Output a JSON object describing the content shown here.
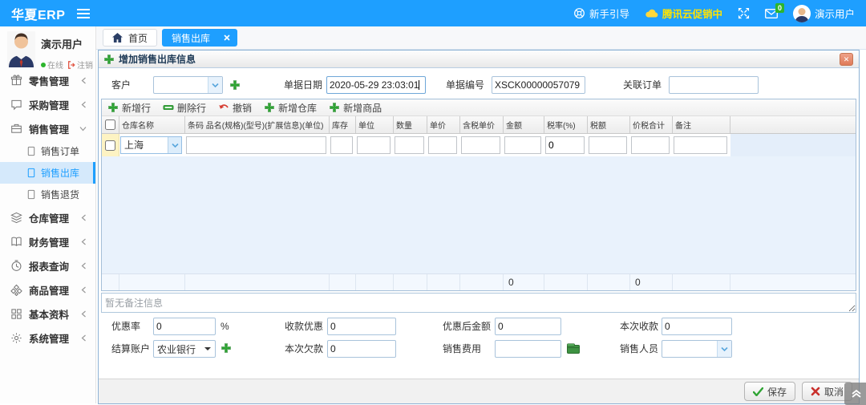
{
  "topbar": {
    "brand": "华夏ERP",
    "guide": "新手引导",
    "promo": "腾讯云促销中",
    "user": "演示用户",
    "mail_badge": "0",
    "bar_color": "#1E9FFF",
    "promo_color": "#FFE400"
  },
  "sidebar": {
    "user": {
      "name": "演示用户",
      "online": "在线",
      "logout": "注销"
    },
    "menu": [
      {
        "label": "零售管理",
        "icon": "gift-icon",
        "state": "collapsed"
      },
      {
        "label": "采购管理",
        "icon": "chat-icon",
        "state": "collapsed"
      },
      {
        "label": "销售管理",
        "icon": "briefcase-icon",
        "state": "expanded",
        "children": [
          {
            "label": "销售订单",
            "selected": false
          },
          {
            "label": "销售出库",
            "selected": true
          },
          {
            "label": "销售退货",
            "selected": false
          }
        ]
      },
      {
        "label": "仓库管理",
        "icon": "layers-icon",
        "state": "collapsed"
      },
      {
        "label": "财务管理",
        "icon": "book-icon",
        "state": "collapsed"
      },
      {
        "label": "报表查询",
        "icon": "clock-icon",
        "state": "collapsed"
      },
      {
        "label": "商品管理",
        "icon": "goods-icon",
        "state": "collapsed"
      },
      {
        "label": "基本资料",
        "icon": "grid-icon",
        "state": "collapsed"
      },
      {
        "label": "系统管理",
        "icon": "gear-icon",
        "state": "collapsed"
      }
    ]
  },
  "tabs": [
    {
      "label": "首页",
      "icon": "home-icon",
      "active": false
    },
    {
      "label": "销售出库",
      "active": true,
      "closable": true
    }
  ],
  "panel": {
    "title": "增加销售出库信息",
    "form_top": [
      {
        "label": "客户",
        "type": "combo",
        "value": ""
      },
      {
        "label": "单据日期",
        "type": "input",
        "value": "2020-05-29 23:03:01",
        "focused": true
      },
      {
        "label": "单据编号",
        "type": "input",
        "value": "XSCK00000057079"
      },
      {
        "label": "关联订单",
        "type": "input",
        "value": ""
      }
    ],
    "toolbar": [
      {
        "label": "新增行",
        "icon": "plus-icon"
      },
      {
        "label": "删除行",
        "icon": "minus-icon"
      },
      {
        "label": "撤销",
        "icon": "undo-icon"
      },
      {
        "label": "新增仓库",
        "icon": "plus-icon"
      },
      {
        "label": "新增商品",
        "icon": "plus-icon"
      }
    ],
    "grid": {
      "columns": [
        "仓库名称",
        "条码 品名(规格)(型号)(扩展信息)(单位)",
        "库存",
        "单位",
        "数量",
        "单价",
        "含税单价",
        "金额",
        "税率(%)",
        "税额",
        "价税合计",
        "备注"
      ],
      "row": {
        "warehouse": "上海",
        "tax_rate": "0"
      },
      "footer_amount": "0",
      "footer_total": "0"
    },
    "remark_placeholder": "暂无备注信息",
    "form_bottom": [
      [
        {
          "label": "优惠率",
          "value": "0",
          "suffix": "%"
        },
        {
          "label": "收款优惠",
          "value": "0"
        },
        {
          "label": "优惠后金额",
          "value": "0"
        },
        {
          "label": "本次收款",
          "value": "0"
        }
      ],
      [
        {
          "label": "结算账户",
          "value": "农业银行",
          "type": "select",
          "add": true
        },
        {
          "label": "本次欠款",
          "value": "0"
        },
        {
          "label": "销售费用",
          "value": "",
          "money": true
        },
        {
          "label": "销售人员",
          "value": "",
          "type": "combo"
        }
      ]
    ],
    "save": "保存",
    "cancel": "取消"
  }
}
